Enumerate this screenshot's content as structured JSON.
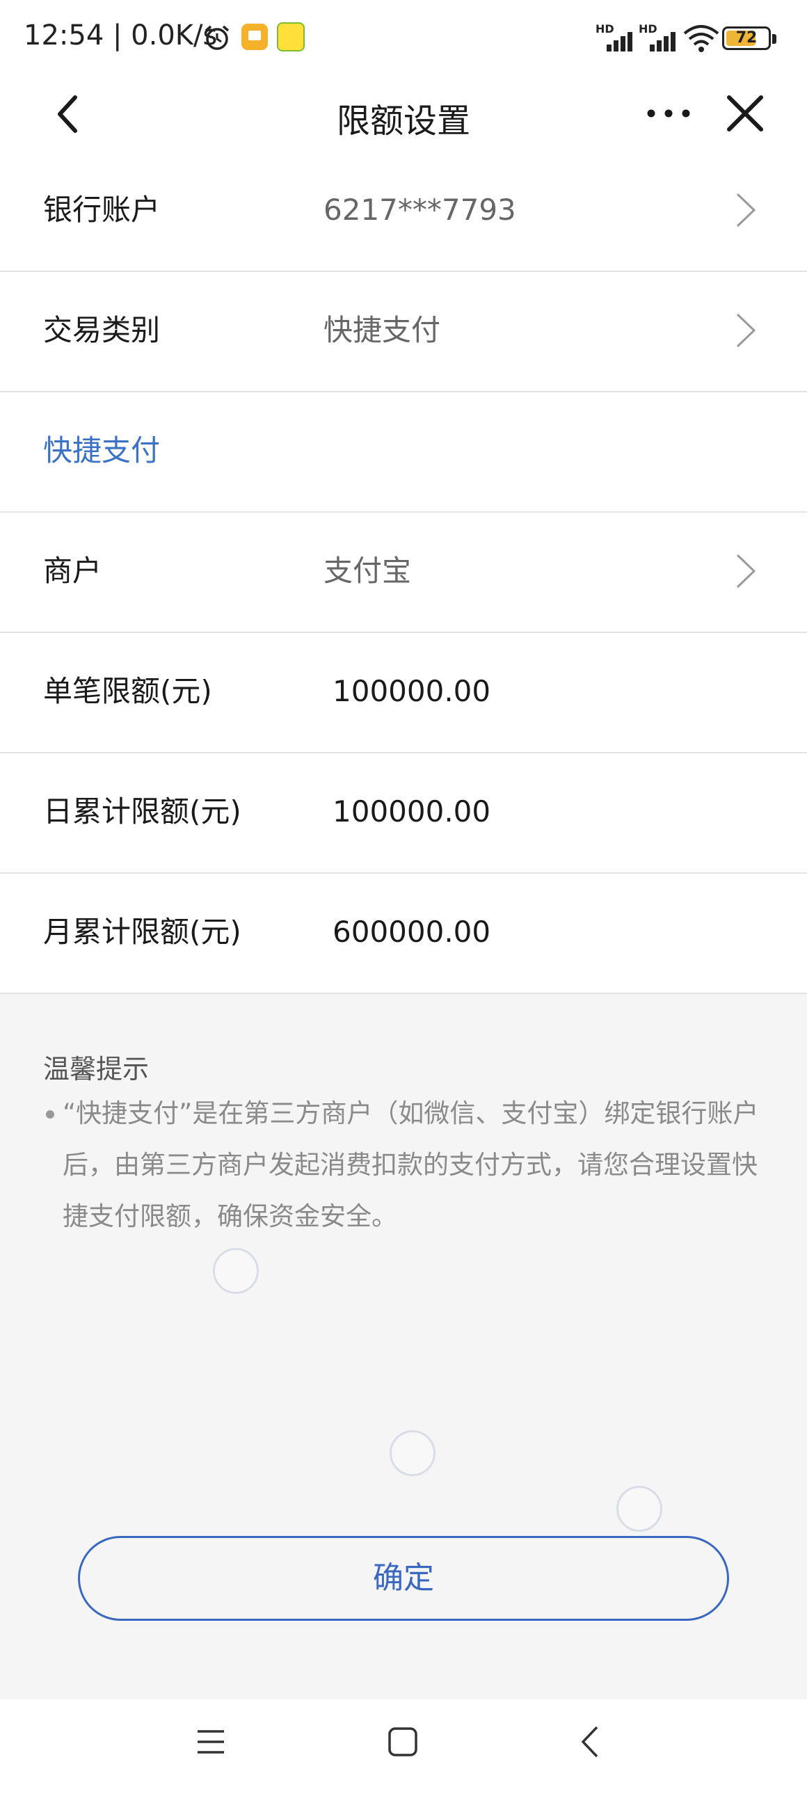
{
  "status_bar": {
    "time_speed": "12:54 | 0.0K/s",
    "battery_level": "72",
    "battery_fraction": 0.72,
    "icons": [
      "alarm-icon",
      "app-notification-icon",
      "app-notification-icon-2",
      "hd-signal-icon",
      "hd-signal-icon",
      "wifi-icon",
      "battery-icon"
    ],
    "hd_label": "HD"
  },
  "navbar": {
    "title": "限额设置",
    "icons": [
      "back-arrow-icon",
      "more-dots-icon",
      "close-icon"
    ]
  },
  "rows": {
    "bank_account": {
      "label": "银行账户",
      "value": "6217***7793"
    },
    "transaction_type": {
      "label": "交易类别",
      "value": "快捷支付"
    },
    "section_title": "快捷支付",
    "merchant": {
      "label": "商户",
      "value": "支付宝"
    },
    "single_limit": {
      "label": "单笔限额(元)",
      "value": "100000.00"
    },
    "daily_limit": {
      "label": "日累计限额(元)",
      "value": "100000.00"
    },
    "monthly_limit": {
      "label": "月累计限额(元)",
      "value": "600000.00"
    }
  },
  "tips": {
    "title": "温馨提示",
    "text": "“快捷支付”是在第三方商户（如微信、支付宝）绑定银行账户后，由第三方商户发起消费扣款的支付方式，请您合理设置快捷支付限额，确保资金安全。"
  },
  "confirm_button": {
    "label": "确定"
  },
  "colors": {
    "accent": "#3a68c0",
    "link_blue": "#3a72c6",
    "background": "#f5f5f5",
    "battery": "#f0b536"
  },
  "system_nav": {
    "icons": [
      "menu-icon",
      "home-icon",
      "back-icon"
    ]
  }
}
